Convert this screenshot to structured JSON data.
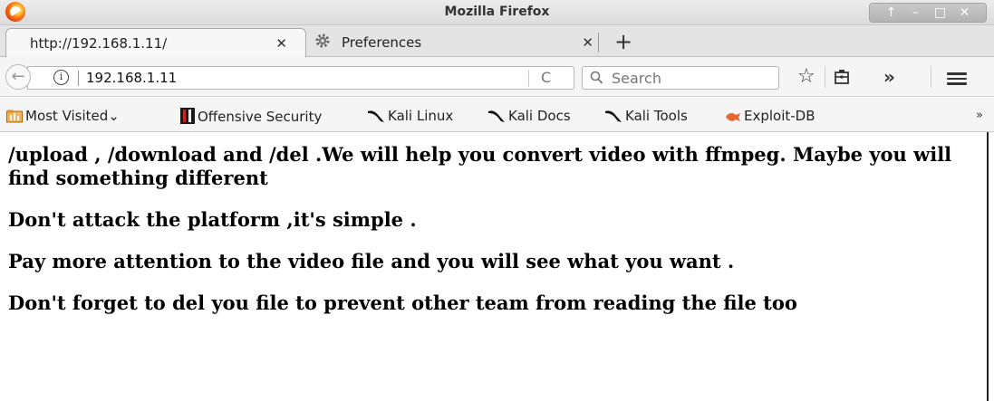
{
  "window": {
    "title": "Mozilla Firefox",
    "controls": [
      "↑",
      "–",
      "□",
      "✕"
    ]
  },
  "tabs": [
    {
      "label": "http://192.168.1.11/",
      "close": "✕",
      "active": true
    },
    {
      "label": "Preferences",
      "close": "✕",
      "active": false
    }
  ],
  "new_tab_label": "+",
  "navbar": {
    "url": "192.168.1.11",
    "search_placeholder": "Search",
    "back_glyph": "←",
    "info_glyph": "i",
    "reload_glyph": "C",
    "star_glyph": "☆",
    "overflow_glyph": "»"
  },
  "bookmarks": {
    "items": [
      {
        "label": "Most Visited",
        "icon": "most-visited-icon",
        "suffix": "⌄"
      },
      {
        "label": "Offensive Security",
        "icon": "offsec-icon"
      },
      {
        "label": "Kali Linux",
        "icon": "kali-dragon-icon"
      },
      {
        "label": "Kali Docs",
        "icon": "kali-dragon-icon"
      },
      {
        "label": "Kali Tools",
        "icon": "kali-dragon-icon"
      },
      {
        "label": "Exploit-DB",
        "icon": "exploit-db-icon"
      }
    ],
    "more": "»"
  },
  "content": {
    "paragraphs": [
      "/upload , /download and /del .We will help you convert video with ffmpeg. Maybe you will find something different",
      "Don't attack the platform ,it's simple .",
      "Pay more attention to the video file and you will see what you want .",
      "Don't forget to del you file to prevent other team from reading the file too"
    ]
  },
  "colors": {
    "exploit_db": "#e8652f",
    "most_visited": "#d9822b"
  }
}
